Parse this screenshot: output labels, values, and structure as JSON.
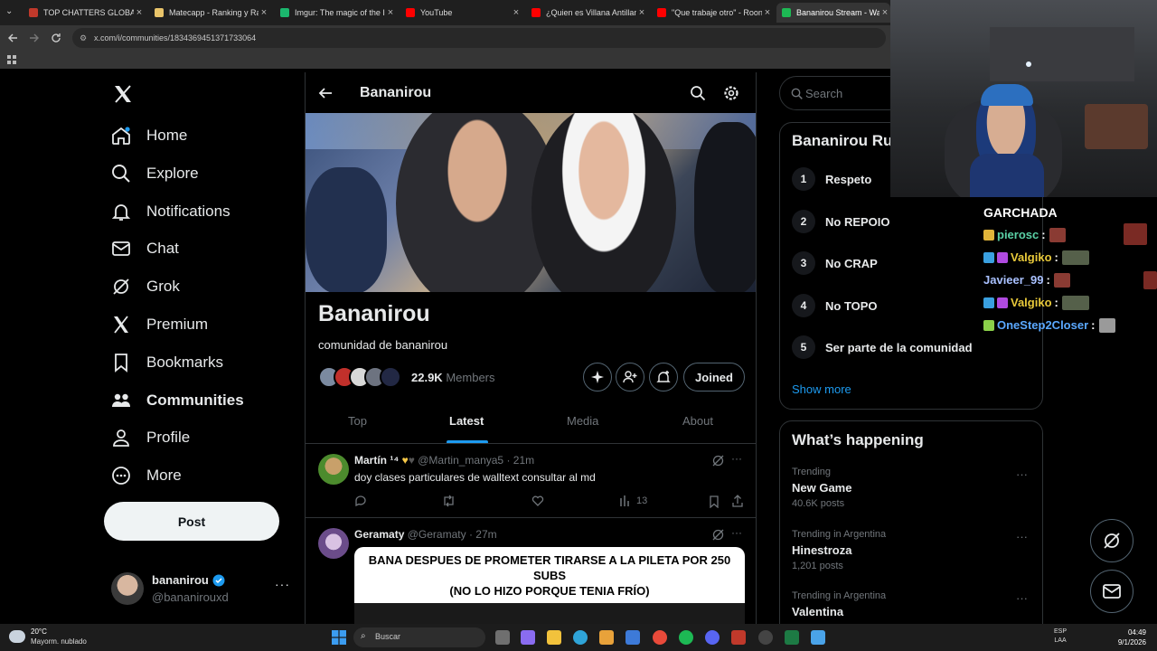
{
  "browser": {
    "tabs": [
      {
        "title": "TOP CHATTERS GLOBAL",
        "color": "#c0392b"
      },
      {
        "title": "Matecapp - Ranking y Ra",
        "color": "#e9c46a"
      },
      {
        "title": "Imgur: The magic of the I",
        "color": "#1bb76e"
      },
      {
        "title": "YouTube",
        "color": "#ff0000"
      },
      {
        "title": "¿Quien es Villana Antillan",
        "color": "#ff0000"
      },
      {
        "title": "\"Que trabaje otro\" - Roon",
        "color": "#ff0000"
      },
      {
        "title": "Bananirou Stream - Watc",
        "color": "#1db954"
      }
    ],
    "url": "x.com/i/communities/1834369451371733064"
  },
  "nav": {
    "items": [
      {
        "label": "Home",
        "icon": "home-icon"
      },
      {
        "label": "Explore",
        "icon": "search-icon"
      },
      {
        "label": "Notifications",
        "icon": "bell-icon"
      },
      {
        "label": "Chat",
        "icon": "mail-icon"
      },
      {
        "label": "Grok",
        "icon": "grok-icon"
      },
      {
        "label": "Premium",
        "icon": "x-logo-icon"
      },
      {
        "label": "Bookmarks",
        "icon": "bookmark-icon"
      },
      {
        "label": "Communities",
        "icon": "communities-icon"
      },
      {
        "label": "Profile",
        "icon": "person-icon"
      },
      {
        "label": "More",
        "icon": "more-circle-icon"
      }
    ],
    "post_label": "Post",
    "account": {
      "name": "bananirou",
      "handle": "@bananirouxd"
    }
  },
  "community": {
    "header_title": "Bananirou",
    "name": "Bananirou",
    "description": "comunidad de bananirou",
    "members_count": "22.9K",
    "members_label": "Members",
    "joined_label": "Joined",
    "tabs": [
      "Top",
      "Latest",
      "Media",
      "About"
    ],
    "active_tab": "Latest"
  },
  "posts": [
    {
      "name": "Martín",
      "superscript": "¹⁴",
      "handle": "@Martin_manya5",
      "time": "· 21m",
      "text": "doy clases particulares de walltext consultar al md",
      "views": "13"
    },
    {
      "name": "Geramaty",
      "handle": "@Geramaty",
      "time": "· 27m",
      "meme_line1": "BANA DESPUES DE PROMETER TIRARSE A LA PILETA POR 250",
      "meme_line2": "SUBS",
      "meme_line3": "(NO LO HIZO PORQUE TENIA FRÍO)"
    }
  ],
  "right": {
    "search_placeholder": "Search",
    "rules_title": "Bananirou Ru",
    "rules": [
      {
        "num": "1",
        "text": "Respeto"
      },
      {
        "num": "2",
        "text": "No REPOIO"
      },
      {
        "num": "3",
        "text": "No CRAP"
      },
      {
        "num": "4",
        "text": "No TOPO"
      },
      {
        "num": "5",
        "text": "Ser parte de la comunidad"
      }
    ],
    "show_more": "Show more",
    "happening_title": "What’s happening",
    "trends": [
      {
        "context": "Trending",
        "title": "New Game",
        "posts": "40.6K posts"
      },
      {
        "context": "Trending in Argentina",
        "title": "Hinestroza",
        "posts": "1,201 posts"
      },
      {
        "context": "Trending in Argentina",
        "title": "Valentina",
        "posts": ""
      }
    ]
  },
  "stream_chat": {
    "header": "GARCHADA",
    "lines": [
      {
        "user": "pierosc",
        "color": "#5ad1a6"
      },
      {
        "user": "Valgiko",
        "color": "#e8c93a"
      },
      {
        "user": "Javieer_99",
        "color": "#a9c1ff"
      },
      {
        "user": "Valgiko",
        "color": "#e8c93a"
      },
      {
        "user": "OneStep2Closer",
        "color": "#5aa8ff"
      }
    ],
    "separator": ":"
  },
  "taskbar": {
    "weather_temp": "20°C",
    "weather_desc": "Mayorm. nublado",
    "search_label": "Buscar",
    "lang1": "ESP",
    "lang2": "LAA",
    "time": "04:49",
    "date": "9/1/2026"
  }
}
